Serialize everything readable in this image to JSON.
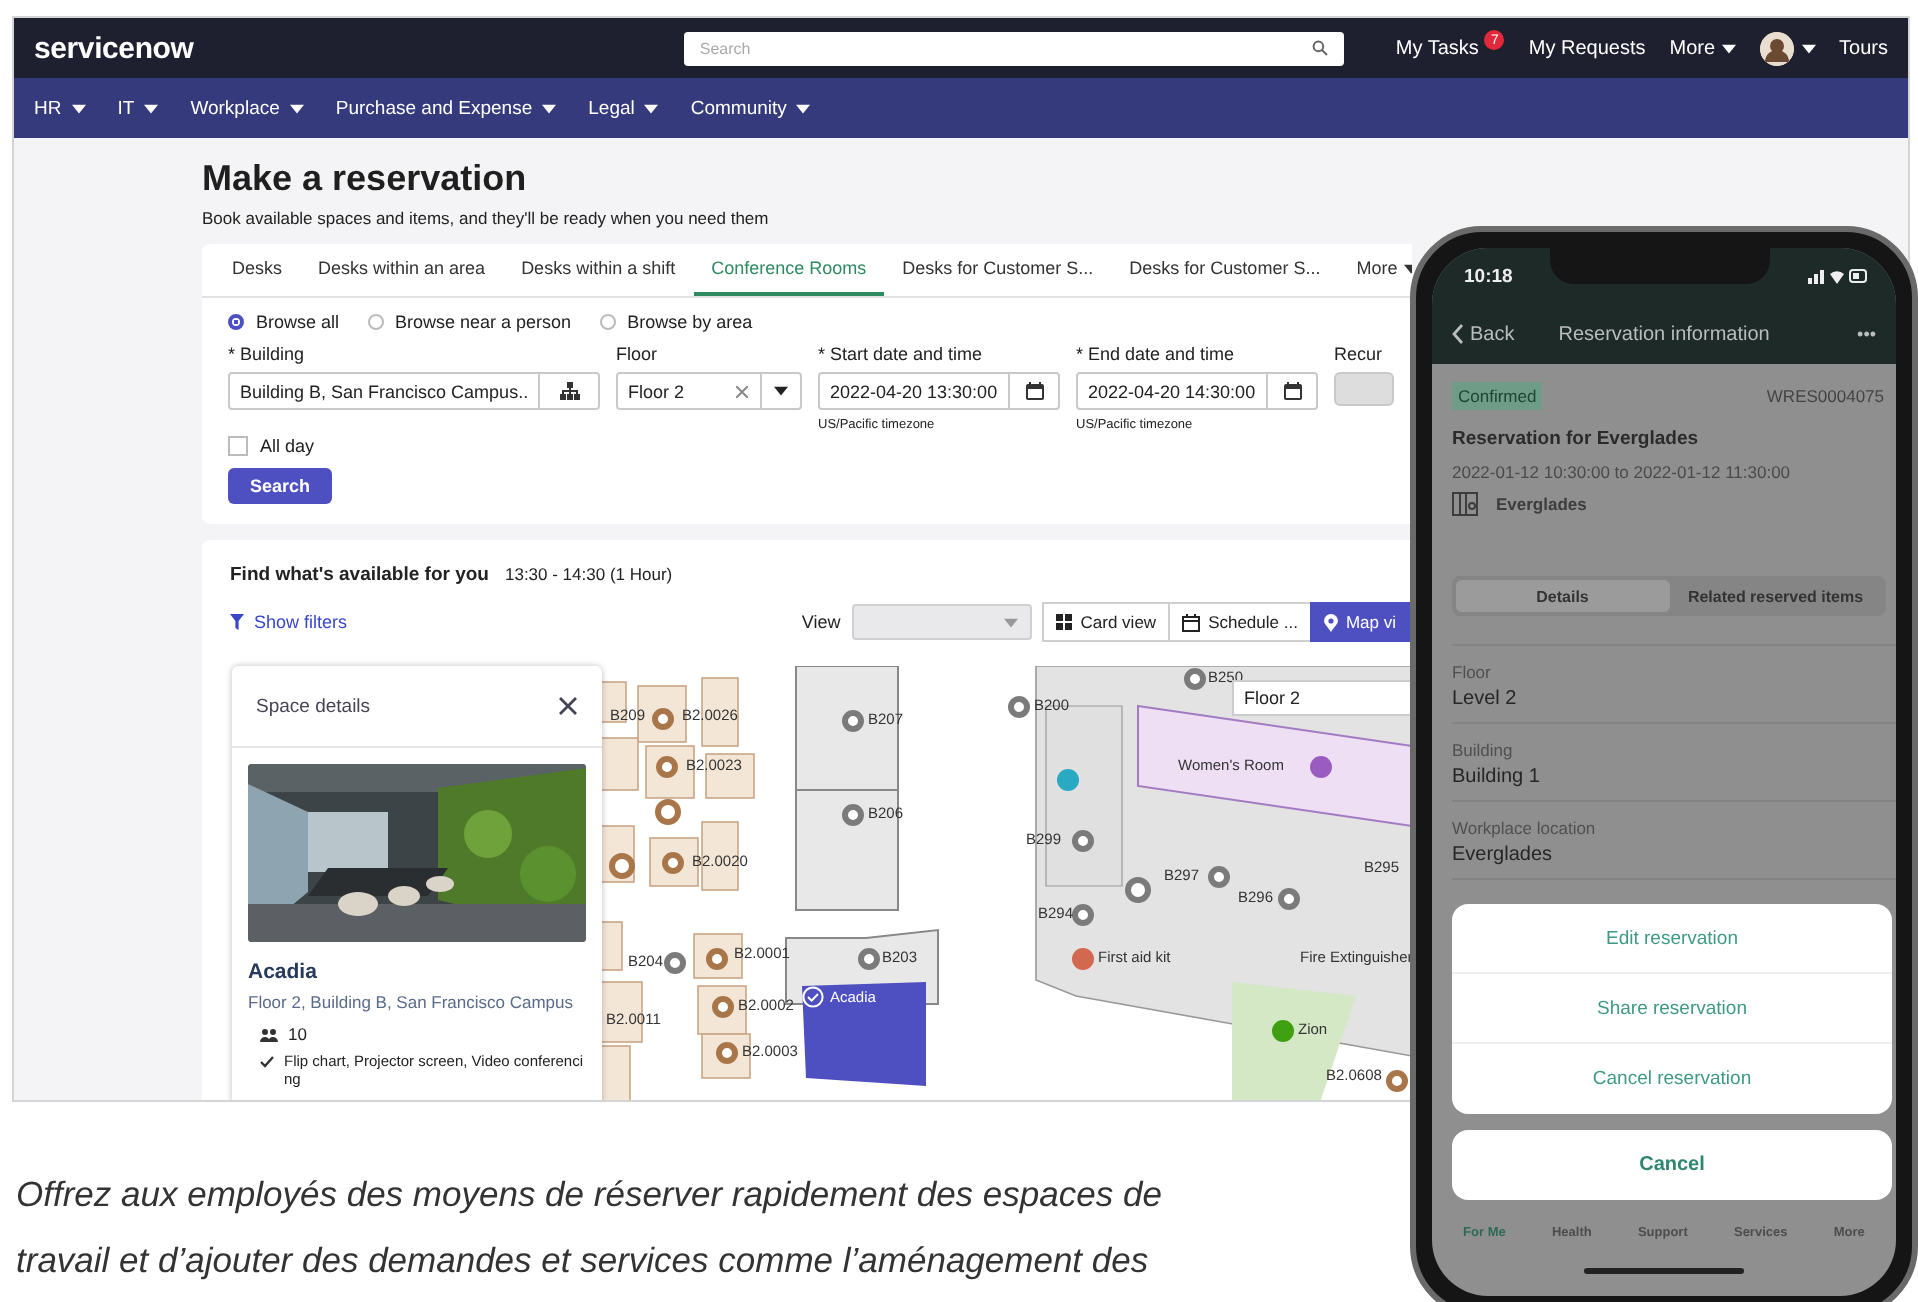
{
  "header": {
    "logo": "servicenow",
    "search": {
      "placeholder": "Search"
    },
    "links": [
      {
        "label": "My Tasks",
        "badge": "7",
        "caret": false
      },
      {
        "label": "My Requests",
        "caret": false
      },
      {
        "label": "More",
        "caret": true
      }
    ],
    "account": {
      "caret": true
    },
    "tours": "Tours"
  },
  "nav": [
    {
      "label": "HR"
    },
    {
      "label": "IT"
    },
    {
      "label": "Workplace"
    },
    {
      "label": "Purchase and Expense"
    },
    {
      "label": "Legal"
    },
    {
      "label": "Community"
    }
  ],
  "page": {
    "title": "Make a reservation",
    "subtitle": "Book available spaces and items, and they'll be ready when you need them"
  },
  "tabs": [
    {
      "label": "Desks",
      "selected": false
    },
    {
      "label": "Desks within an area",
      "selected": false
    },
    {
      "label": "Desks within a shift",
      "selected": false
    },
    {
      "label": "Conference Rooms",
      "selected": true
    },
    {
      "label": "Desks for Customer S...",
      "selected": false
    },
    {
      "label": "Desks for Customer S...",
      "selected": false
    },
    {
      "label": "More",
      "selected": false,
      "caret": true
    }
  ],
  "browse": [
    {
      "label": "Browse all",
      "selected": true
    },
    {
      "label": "Browse near a person",
      "selected": false
    },
    {
      "label": "Browse by area",
      "selected": false
    }
  ],
  "fields": [
    {
      "kind": "lookup",
      "label": "* Building",
      "value": "Building B, San Francisco Campus.."
    },
    {
      "kind": "select",
      "label": "Floor",
      "value": "Floor 2"
    },
    {
      "kind": "datetime",
      "label": "* Start date and time",
      "value": "2022-04-20 13:30:00",
      "hint": "US/Pacific timezone"
    },
    {
      "kind": "datetime",
      "label": "* End date and time",
      "value": "2022-04-20 14:30:00",
      "hint": "US/Pacific timezone"
    },
    {
      "kind": "toggle",
      "label": "Recur",
      "on": false
    }
  ],
  "all_day": {
    "label": "All day",
    "checked": false
  },
  "search_button": "Search",
  "results": {
    "title": "Find what's available for you",
    "time": "13:30 - 14:30 (1 Hour)",
    "filters": "Show filters",
    "view_label": "View",
    "views": [
      {
        "label": "Card view",
        "selected": false
      },
      {
        "label": "Schedule ...",
        "selected": false
      },
      {
        "label": "Map vi",
        "selected": true
      }
    ]
  },
  "space_details": {
    "title": "Space details",
    "name": "Acadia",
    "location": "Floor 2, Building B, San Francisco Campus",
    "capacity": "10",
    "amenities": "Flip chart, Projector screen, Video conferencing"
  },
  "map": {
    "selected_space": "Acadia",
    "items": [
      {
        "label": "B209",
        "kind": "label"
      },
      {
        "label": "B2.0026",
        "kind": "desk"
      },
      {
        "label": "B2.0023",
        "kind": "desk"
      },
      {
        "label": "B2.0020",
        "kind": "desk"
      },
      {
        "label": "B207",
        "kind": "room"
      },
      {
        "label": "B206",
        "kind": "room"
      },
      {
        "label": "B200",
        "kind": "room"
      },
      {
        "label": "B250",
        "kind": "room"
      },
      {
        "label": "Floor 2",
        "kind": "floor"
      },
      {
        "label": "Women's Room",
        "kind": "restroom"
      },
      {
        "label": "B299",
        "kind": "room"
      },
      {
        "label": "B297",
        "kind": "room"
      },
      {
        "label": "B296",
        "kind": "room"
      },
      {
        "label": "B295",
        "kind": "label"
      },
      {
        "label": "B294",
        "kind": "room"
      },
      {
        "label": "B204",
        "kind": "room"
      },
      {
        "label": "B2.0001",
        "kind": "desk"
      },
      {
        "label": "B203",
        "kind": "room"
      },
      {
        "label": "First aid kit",
        "kind": "firstaid"
      },
      {
        "label": "Fire Extinguisher",
        "kind": "label"
      },
      {
        "label": "B2.0011",
        "kind": "label"
      },
      {
        "label": "B2.0002",
        "kind": "desk"
      },
      {
        "label": "B2.0003",
        "kind": "desk"
      },
      {
        "label": "Zion",
        "kind": "space"
      },
      {
        "label": "B2.0608",
        "kind": "desk"
      }
    ]
  },
  "caption": [
    "Offrez aux employés des moyens de réserver rapidement des espaces de",
    "travail et d’ajouter des demandes et services comme l’aménagement des"
  ],
  "phone": {
    "time": "10:18",
    "back": "Back",
    "title": "Reservation information",
    "more": "•••",
    "status": "Confirmed",
    "number": "WRES0004075",
    "heading": "Reservation for Everglades",
    "when": "2022-01-12 10:30:00 to 2022-01-12 11:30:00",
    "room": "Everglades",
    "segments": [
      {
        "label": "Details",
        "selected": true
      },
      {
        "label": "Related reserved items",
        "selected": false
      }
    ],
    "details": [
      {
        "label": "Floor",
        "value": "Level 2"
      },
      {
        "label": "Building",
        "value": "Building 1"
      },
      {
        "label": "Workplace location",
        "value": "Everglades"
      }
    ],
    "actions": [
      "Edit reservation",
      "Share reservation",
      "Cancel reservation"
    ],
    "cancel": "Cancel",
    "tabbar": [
      {
        "label": "For Me",
        "selected": true
      },
      {
        "label": "Health",
        "selected": false
      },
      {
        "label": "Support",
        "selected": false
      },
      {
        "label": "Services",
        "selected": false
      },
      {
        "label": "More",
        "selected": false
      }
    ]
  }
}
